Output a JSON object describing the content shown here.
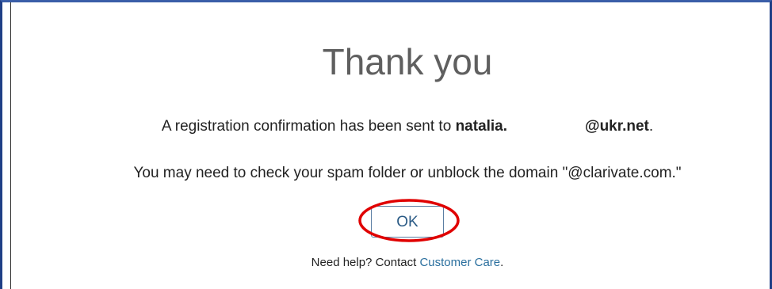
{
  "dialog": {
    "title": "Thank you",
    "confirmation": {
      "prefix": "A registration confirmation has been sent to ",
      "email_user": "natalia.",
      "email_domain": "@ukr.net",
      "suffix": "."
    },
    "spam_notice": "You may need to check your spam folder or unblock the domain \"@clarivate.com.\"",
    "ok_label": "OK",
    "help": {
      "prefix": "Need help? Contact ",
      "link_label": "Customer Care",
      "suffix": "."
    }
  },
  "annotation": {
    "highlight_color": "#e00000"
  },
  "colors": {
    "frame_border": "#1f3f86",
    "link": "#2a6f9e",
    "button_text": "#2a5a85"
  }
}
